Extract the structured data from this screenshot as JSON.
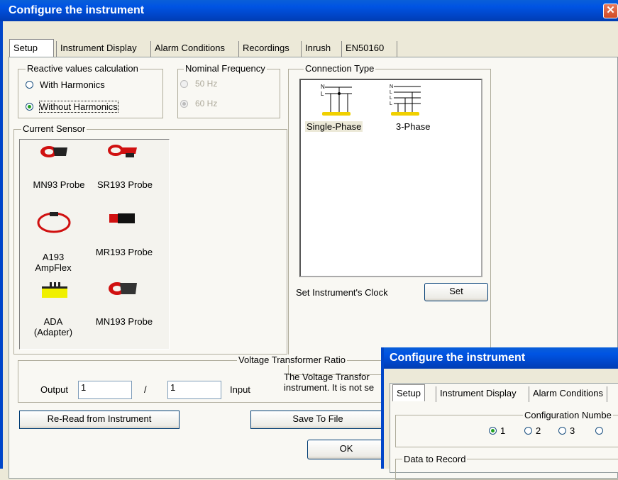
{
  "window": {
    "title": "Configure the instrument",
    "close_glyph": "✕"
  },
  "tabs": [
    "Setup",
    "Instrument Display",
    "Alarm Conditions",
    "Recordings",
    "Inrush",
    "EN50160"
  ],
  "reactive": {
    "legend": "Reactive values calculation",
    "options": [
      "With Harmonics",
      "Without Harmonics"
    ],
    "selected": 1
  },
  "frequency": {
    "legend": "Nominal Frequency",
    "options": [
      "50 Hz",
      "60 Hz"
    ],
    "selected": 1,
    "disabled": true
  },
  "connection": {
    "legend": "Connection Type",
    "items": [
      "Single-Phase",
      "3-Phase"
    ],
    "selected": 0
  },
  "clock": {
    "label": "Set Instrument's Clock",
    "button": "Set"
  },
  "current_sensor": {
    "legend": "Current Sensor",
    "items": [
      {
        "label": "MN93 Probe",
        "icon": "mn93-probe-icon"
      },
      {
        "label": "SR193 Probe",
        "icon": "sr193-probe-icon"
      },
      {
        "label": "A193\nAmpFlex",
        "icon": "ampflex-icon"
      },
      {
        "label": "MR193 Probe",
        "icon": "mr193-probe-icon"
      },
      {
        "label": "ADA\n(Adapter)",
        "icon": "adapter-icon"
      },
      {
        "label": "MN193 Probe",
        "icon": "mn193-probe-icon"
      }
    ]
  },
  "vt": {
    "legend": "Voltage Transformer Ratio",
    "output_label": "Output",
    "output_value": "1",
    "slash": "/",
    "input_value": "1",
    "input_label": "Input",
    "note_line1": "The Voltage Transfor",
    "note_line2": "instrument. It is not se"
  },
  "buttons": {
    "reread": "Re-Read from Instrument",
    "save": "Save To File",
    "ok": "OK"
  },
  "dialog2": {
    "title": "Configure the instrument",
    "tabs": [
      "Setup",
      "Instrument Display",
      "Alarm Conditions"
    ],
    "config_legend": "Configuration Numbe",
    "config_options": [
      "1",
      "2",
      "3",
      ""
    ],
    "config_selected": 0,
    "data_legend": "Data to Record"
  },
  "colors": {
    "titlebar": "#0054e3",
    "adapter_yellow": "#f0f000",
    "probe_red": "#d01010"
  }
}
